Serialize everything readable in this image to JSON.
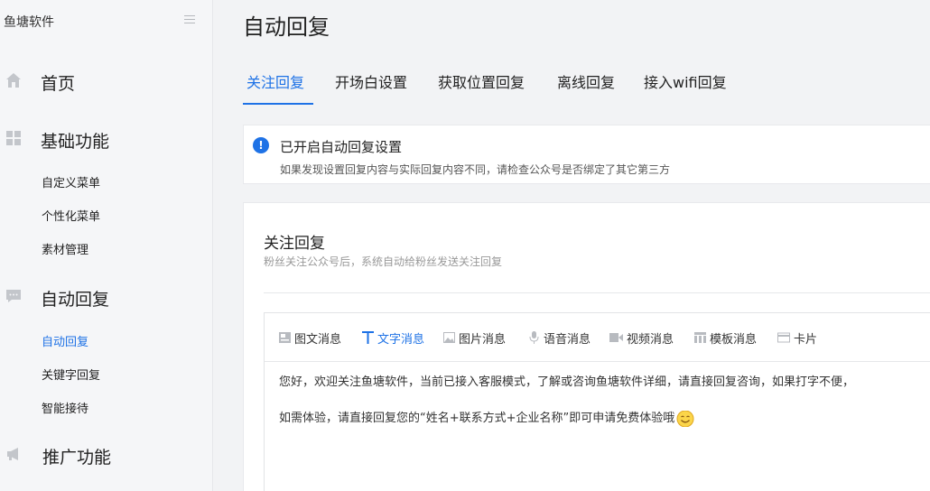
{
  "sidebar": {
    "brand": "鱼塘软件",
    "groups": [
      {
        "label": "首页",
        "icon": "home-icon"
      },
      {
        "label": "基础功能",
        "icon": "grid-icon"
      },
      {
        "label": "自动回复",
        "icon": "chat-icon"
      },
      {
        "label": "推广功能",
        "icon": "megaphone-icon"
      }
    ],
    "basic_items": [
      "自定义菜单",
      "个性化菜单",
      "素材管理"
    ],
    "reply_items": [
      "自动回复",
      "关键字回复",
      "智能接待"
    ],
    "active_item": "自动回复"
  },
  "main": {
    "title": "自动回复",
    "tabs": [
      "关注回复",
      "开场白设置",
      "获取位置回复",
      "离线回复",
      "接入wifi回复"
    ],
    "alert": {
      "icon_glyph": "!",
      "title": "已开启自动回复设置",
      "desc": "如果发现设置回复内容与实际回复内容不同，请检查公众号是否绑定了其它第三方"
    },
    "card": {
      "title": "关注回复",
      "subtitle": "粉丝关注公众号后，系统自动给粉丝发送关注回复"
    },
    "toolbar": {
      "items": [
        "图文消息",
        "文字消息",
        "图片消息",
        "语音消息",
        "视频消息",
        "模板消息",
        "卡片"
      ],
      "active": "文字消息"
    },
    "editor": {
      "line1": "您好，欢迎关注鱼塘软件，当前已接入客服模式，了解或咨询鱼塘软件详细，请直接回复咨询，如果打字不便，",
      "line2": "如需体验，请直接回复您的“姓名+联系方式+企业名称”即可申请免费体验哦"
    }
  },
  "colors": {
    "accent": "#1e72e6",
    "sidebar_bg": "#f5f6f8",
    "page_bg": "#f2f3f5",
    "icon_gray": "#c3c6cb"
  }
}
